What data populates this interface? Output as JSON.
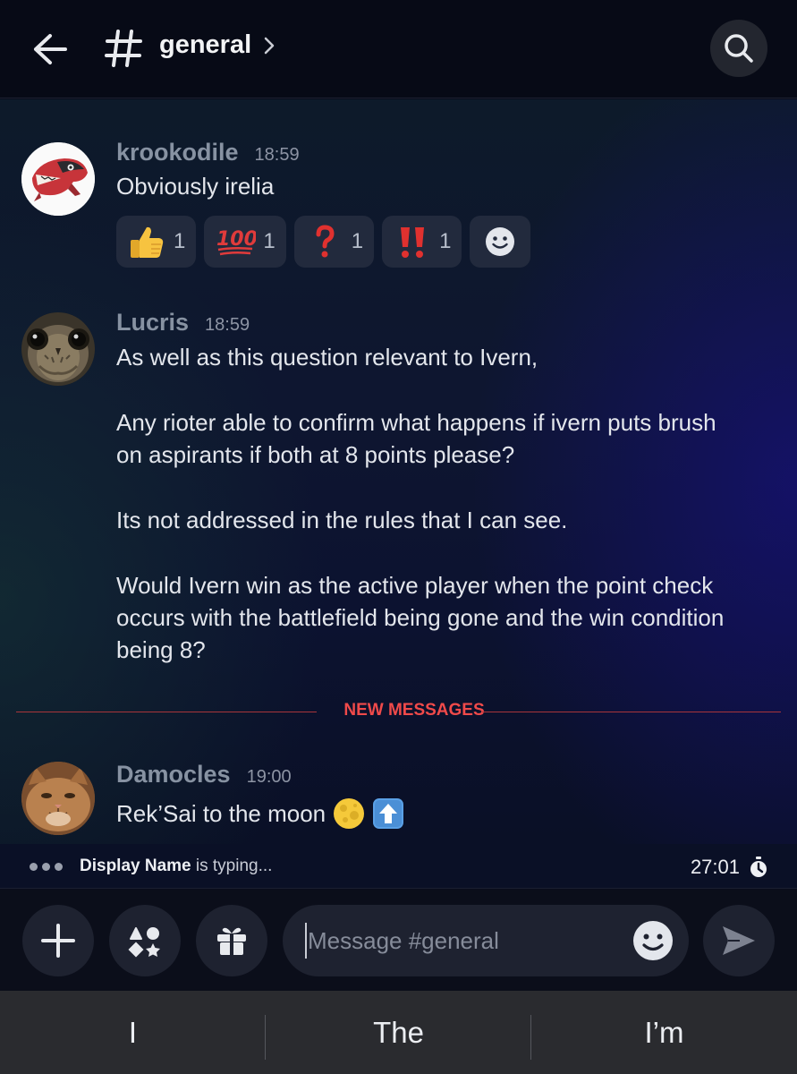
{
  "header": {
    "channel_name": "general",
    "chevron": "›"
  },
  "messages": [
    {
      "username": "krookodile",
      "time": "18:59",
      "avatar": "krookodile-avatar",
      "lines": [
        "Obviously irelia"
      ],
      "reactions": [
        {
          "emoji": "thumbs-up",
          "count": "1"
        },
        {
          "emoji": "hundred-points",
          "count": "1"
        },
        {
          "emoji": "question-mark",
          "count": "1"
        },
        {
          "emoji": "double-exclamation",
          "count": "1"
        }
      ]
    },
    {
      "username": "Lucris",
      "time": "18:59",
      "avatar": "owl-avatar",
      "lines": [
        "As well as this question relevant to Ivern,",
        "",
        "Any rioter able to confirm what happens if ivern puts brush",
        "on aspirants if both at 8 points please?",
        "",
        "Its not addressed in the rules that I can see.",
        "",
        "Would Ivern win as the active player when the point check",
        "occurs with the battlefield being gone and the win condition",
        "being 8?"
      ]
    },
    {
      "username": "Damocles",
      "time": "19:00",
      "avatar": "cat-avatar",
      "lines": [
        "Rek’Sai to the moon"
      ]
    }
  ],
  "divider": {
    "label": "NEW MESSAGES"
  },
  "typing": {
    "name": "Display Name",
    "suffix": " is typing...",
    "timer": "27:01"
  },
  "composer": {
    "placeholder": "Message #general"
  },
  "suggestions": [
    "I",
    "The",
    "I’m"
  ],
  "colors": {
    "accent_red": "#f04a4a",
    "username_gray": "#8792a2",
    "reaction_bg": "#222a3d",
    "input_bg": "#1e2230"
  }
}
